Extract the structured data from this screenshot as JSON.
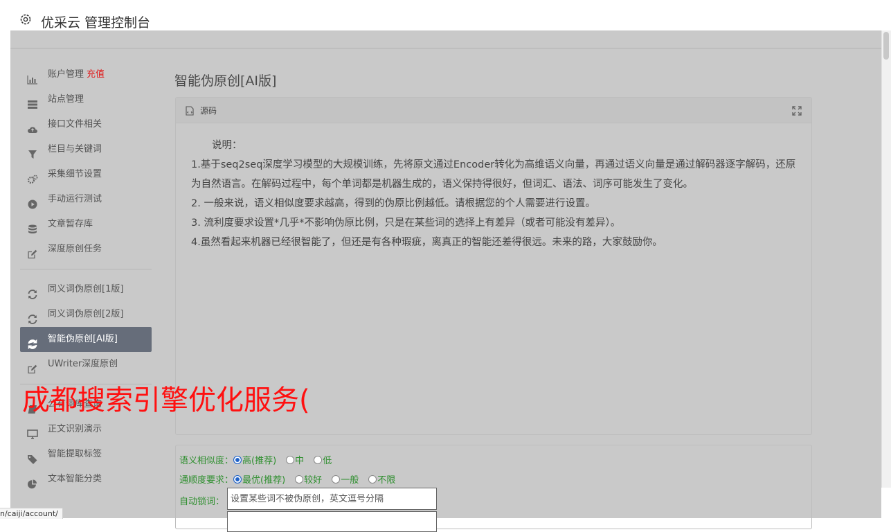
{
  "app": {
    "title": "优采云 管理控制台"
  },
  "nav": {
    "group1": [
      {
        "label": "账户管理",
        "tag": "充值",
        "icon": "bar-chart-icon"
      },
      {
        "label": "站点管理",
        "icon": "server-icon"
      },
      {
        "label": "接口文件相关",
        "icon": "cloud-upload-icon"
      },
      {
        "label": "栏目与关键词",
        "icon": "filter-icon"
      },
      {
        "label": "采集细节设置",
        "icon": "gears-icon"
      },
      {
        "label": "手动运行测试",
        "icon": "play-circle-icon"
      },
      {
        "label": "文章暂存库",
        "icon": "database-icon"
      },
      {
        "label": "深度原创任务",
        "icon": "edit-icon"
      }
    ],
    "group2": [
      {
        "label": "同义词伪原创[1版]",
        "icon": "refresh-icon"
      },
      {
        "label": "同义词伪原创[2版]",
        "icon": "refresh-icon"
      },
      {
        "label": "智能伪原创[AI版]",
        "icon": "refresh-icon",
        "active": true
      },
      {
        "label": "UWriter深度原创",
        "icon": "edit-icon"
      }
    ],
    "group3": [
      {
        "label": "公有词库查询",
        "icon": "book-icon"
      },
      {
        "label": "正文识别演示",
        "icon": "monitor-icon"
      },
      {
        "label": "智能提取标签",
        "icon": "tag-icon"
      },
      {
        "label": "文本智能分类",
        "icon": "pie-chart-icon"
      }
    ]
  },
  "page": {
    "title": "智能伪原创[AI版]"
  },
  "panel": {
    "header_label": "源码",
    "notes": {
      "heading": "说明：",
      "lines": [
        "1.基于seq2seq深度学习模型的大规模训练，先将原文通过Encoder转化为高维语义向量，再通过语义向量是通过解码器逐字解码，还原为自然语言。在解码过程中，每个单词都是机器生成的，语义保持得很好，但词汇、语法、词序可能发生了变化。",
        "2. 一般来说，语义相似度要求越高，得到的伪原比例越低。请根据您的个人需要进行设置。",
        "3. 流利度要求设置*几乎*不影响伪原比例，只是在某些词的选择上有差异（或者可能没有差异）。",
        "4.虽然看起来机器已经很智能了，但还是有各种瑕疵，离真正的智能还差得很远。未来的路，大家鼓励你。"
      ]
    }
  },
  "form": {
    "similarity": {
      "label": "语义相似度：",
      "options": [
        "高(推荐)",
        "中",
        "低"
      ],
      "selected": 0
    },
    "fluency": {
      "label": "通顺度要求：",
      "options": [
        "最优(推荐)",
        "较好",
        "一般",
        "不限"
      ],
      "selected": 0
    },
    "lock": {
      "label": "自动锁词：",
      "placeholder": "设置某些词不被伪原创，英文逗号分隔"
    }
  },
  "overlay": {
    "text": "成都搜索引擎优化服务("
  },
  "statusbar": {
    "url": "n/caiji/account/"
  },
  "colors": {
    "active_nav": "#666d7a",
    "tag_red": "#e01b1b",
    "form_green": "#2f8f2f",
    "overlay_red": "#ff1010"
  }
}
